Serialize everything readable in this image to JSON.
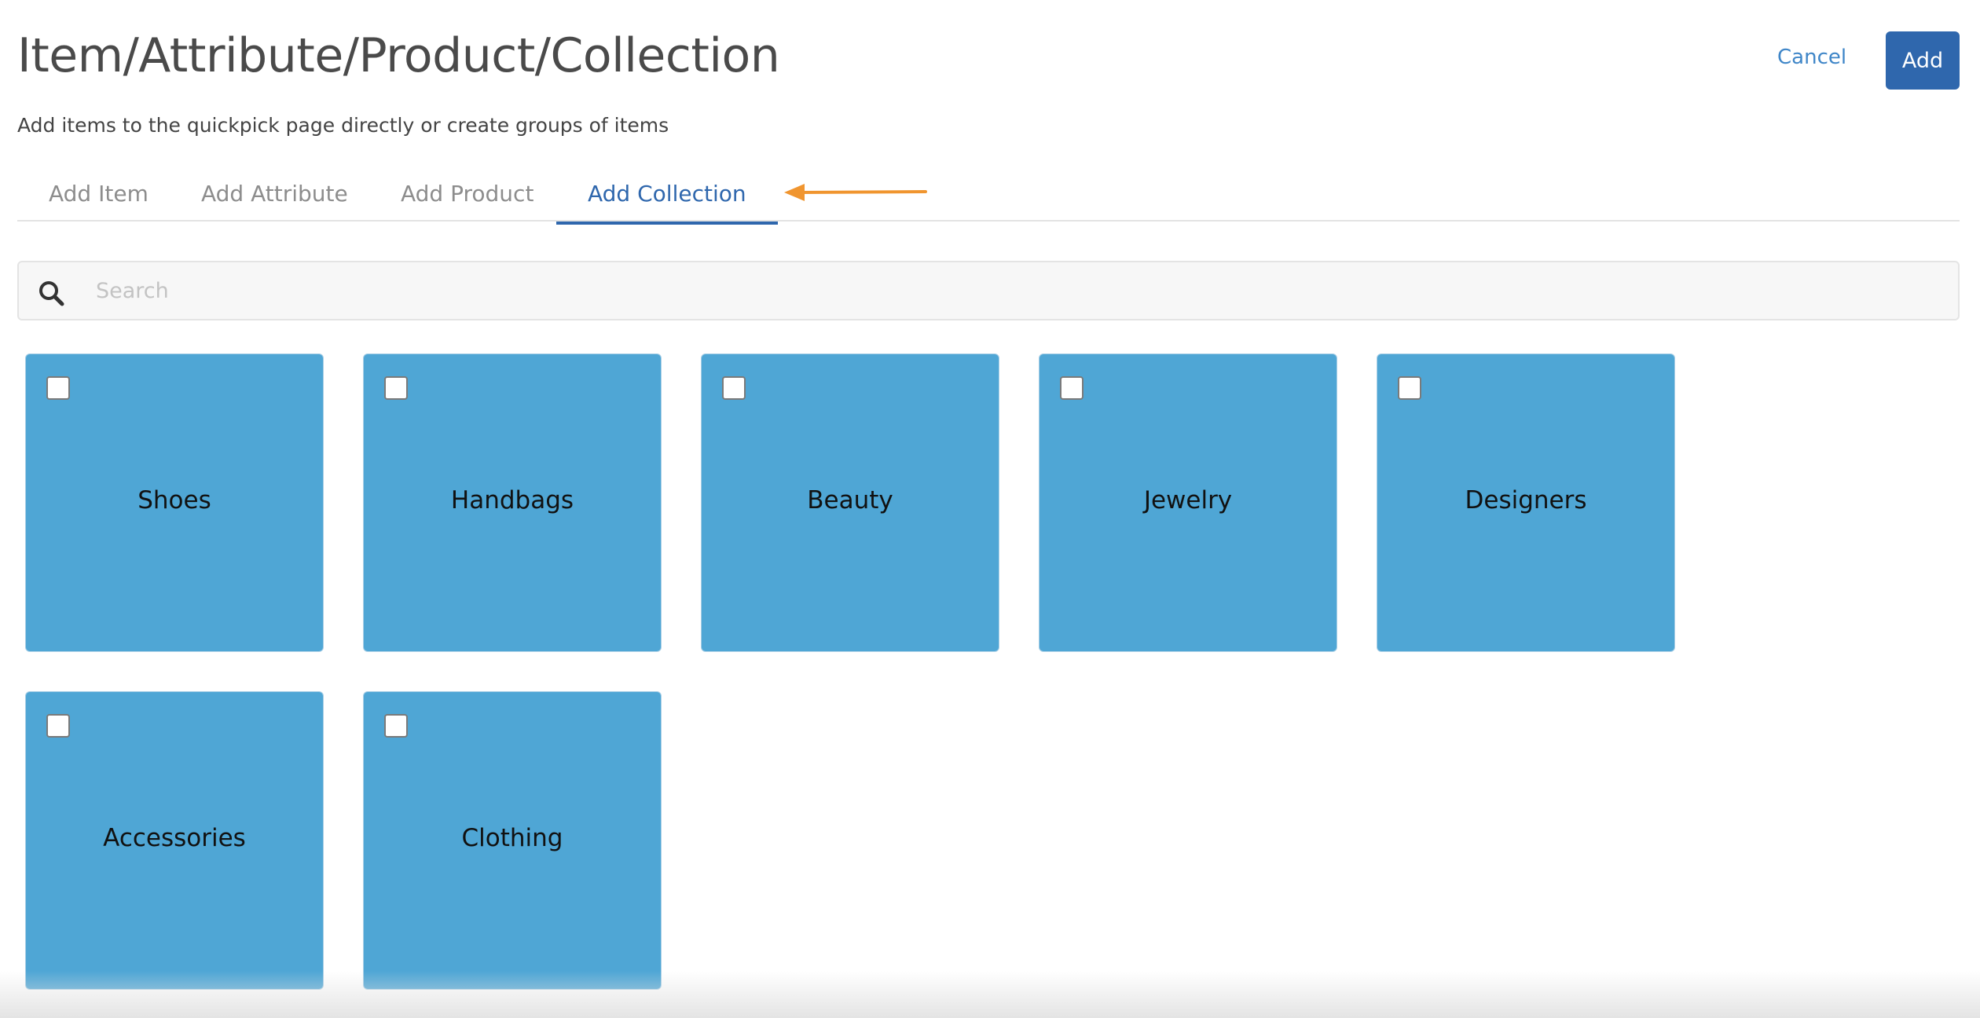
{
  "header": {
    "title": "Item/Attribute/Product/Collection",
    "subtitle": "Add items to the quickpick page directly or create groups of items",
    "cancel_label": "Cancel",
    "add_label": "Add"
  },
  "tabs": [
    {
      "label": "Add Item",
      "active": false
    },
    {
      "label": "Add Attribute",
      "active": false
    },
    {
      "label": "Add Product",
      "active": false
    },
    {
      "label": "Add Collection",
      "active": true
    }
  ],
  "search": {
    "placeholder": "Search",
    "value": "",
    "icon": "search-icon"
  },
  "collections": [
    {
      "label": "Shoes",
      "checked": false
    },
    {
      "label": "Handbags",
      "checked": false
    },
    {
      "label": "Beauty",
      "checked": false
    },
    {
      "label": "Jewelry",
      "checked": false
    },
    {
      "label": "Designers",
      "checked": false
    },
    {
      "label": "Accessories",
      "checked": false
    },
    {
      "label": "Clothing",
      "checked": false
    }
  ],
  "colors": {
    "accent": "#2f67ad",
    "link": "#3f86c8",
    "card": "#4fa6d5",
    "annotation_arrow": "#f0952f"
  }
}
